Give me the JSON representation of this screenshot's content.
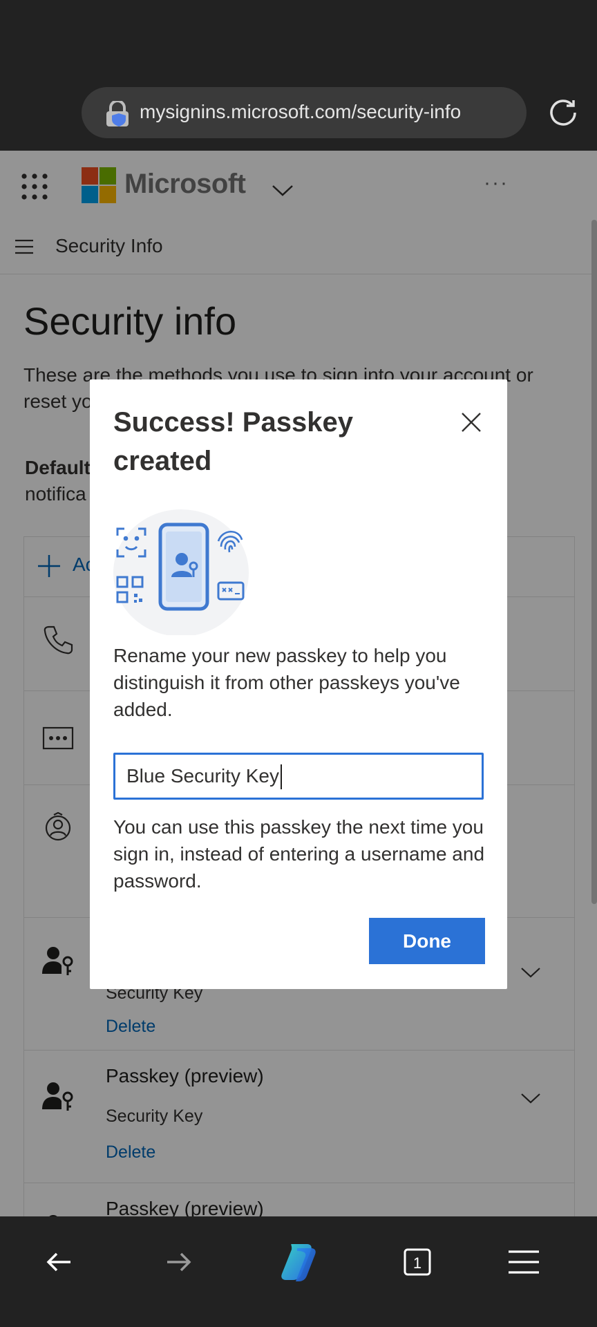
{
  "browser": {
    "url": "mysignins.microsoft.com/security-info",
    "tab_count": "1"
  },
  "header": {
    "brand": "Microsoft",
    "more": "···"
  },
  "nav": {
    "title": "Security Info"
  },
  "page": {
    "heading": "Security info",
    "description": "These are the methods you use to sign into your account or reset yo",
    "default_label": "Default",
    "default_rest": "notifica",
    "add_method_label": "Ac"
  },
  "methods": [
    {
      "name": "Passkey (preview)",
      "sub": "Security Key",
      "delete": "Delete"
    },
    {
      "name": "Passkey (preview)",
      "sub": "Security Key",
      "delete": "Delete"
    },
    {
      "name": "Passkey (preview)"
    }
  ],
  "modal": {
    "title": "Success! Passkey created",
    "intro": "Rename your new passkey to help you distinguish it from other passkeys you've added.",
    "input_value": "Blue Security Key",
    "info": "You can use this passkey the next time you sign in, instead of entering a username and password.",
    "done_label": "Done"
  },
  "colors": {
    "accent": "#2b72d6",
    "link": "#0067b8",
    "chrome": "#222222"
  }
}
